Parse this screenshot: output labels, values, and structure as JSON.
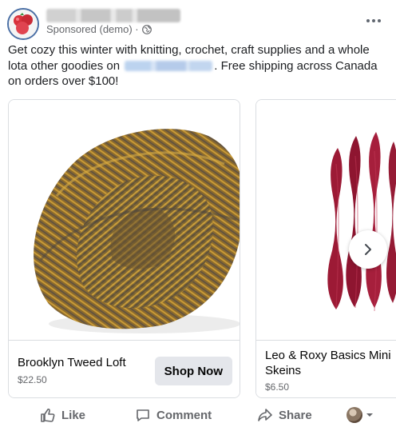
{
  "post": {
    "sponsored_label": "Sponsored (demo) ·",
    "text_before_link": "Get cozy this winter with knitting, crochet, craft supplies and a whole lota other goodies on",
    "text_after_link": ". Free shipping across Canada on orders over $100!"
  },
  "carousel": {
    "cards": [
      {
        "title": "Brooklyn Tweed Loft",
        "price": "$22.50",
        "cta": "Shop Now"
      },
      {
        "title": "Leo & Roxy Basics Mini Skeins",
        "price": "$6.50"
      }
    ]
  },
  "actions": {
    "like": "Like",
    "comment": "Comment",
    "share": "Share"
  },
  "colors": {
    "secondary_text": "#65676b",
    "button_bg": "#e4e6eb",
    "border": "#dadde1",
    "yarn_gold": "#a67f2a",
    "yarn_red": "#9c1a35"
  },
  "icons": [
    "globe-icon",
    "more-dots-icon",
    "chevron-right-icon",
    "like-icon",
    "comment-icon",
    "share-icon",
    "caret-down-icon"
  ]
}
